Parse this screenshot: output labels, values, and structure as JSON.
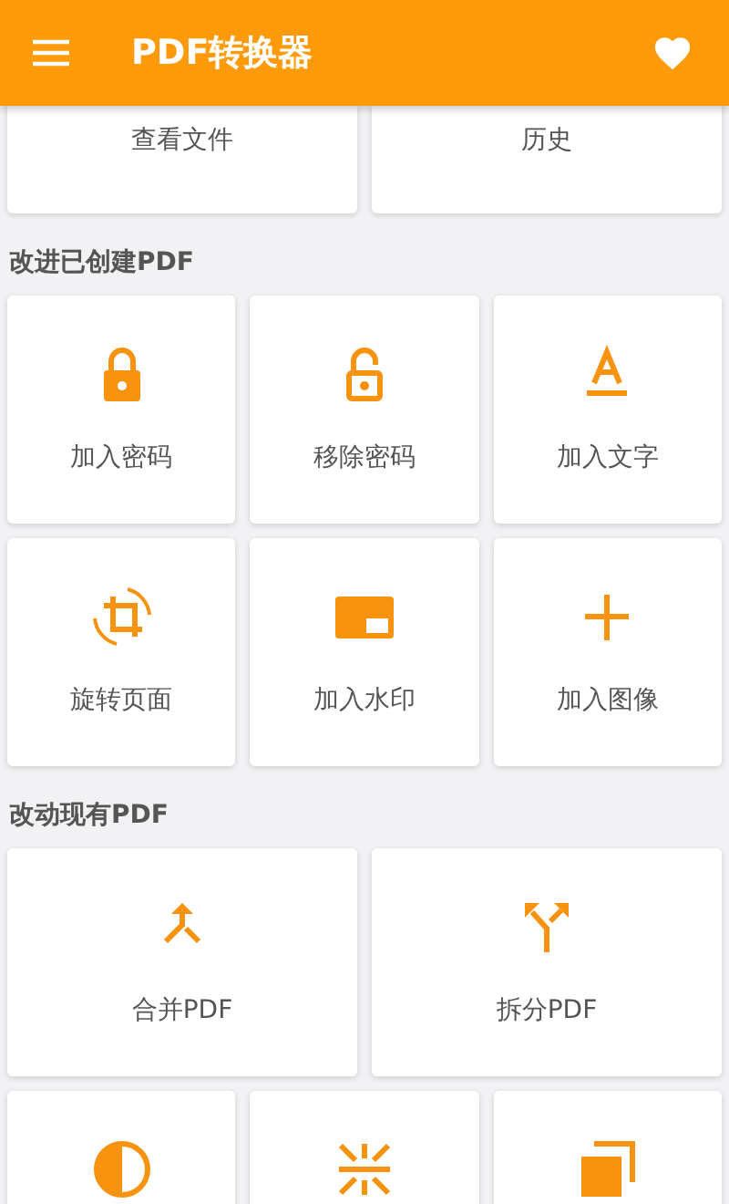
{
  "app_bar": {
    "title": "PDF转换器"
  },
  "top_actions": [
    {
      "label": "查看文件"
    },
    {
      "label": "历史"
    }
  ],
  "sections": [
    {
      "title": "改进已创建PDF",
      "rows": [
        [
          {
            "kind": "lock",
            "label": "加入密码"
          },
          {
            "kind": "unlock",
            "label": "移除密码"
          },
          {
            "kind": "text",
            "label": "加入文字"
          }
        ],
        [
          {
            "kind": "rotate",
            "label": "旋转页面"
          },
          {
            "kind": "watermark",
            "label": "加入水印"
          },
          {
            "kind": "plus",
            "label": "加入图像"
          }
        ]
      ]
    },
    {
      "title": "改动现有PDF",
      "rows": [
        [
          {
            "kind": "merge",
            "label": "合并PDF"
          },
          {
            "kind": "split",
            "label": "拆分PDF"
          }
        ],
        [
          {
            "kind": "contrast"
          },
          {
            "kind": "compress"
          },
          {
            "kind": "copy"
          }
        ]
      ]
    }
  ]
}
